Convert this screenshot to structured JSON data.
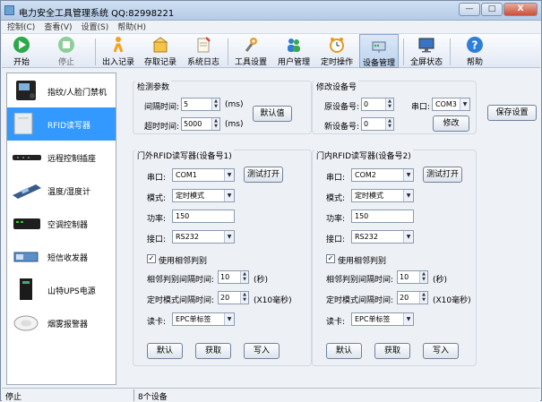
{
  "window": {
    "title": "电力安全工具管理系统  QQ:82998221",
    "controls": {
      "minimize": "—",
      "maximize": "□",
      "close": "X"
    }
  },
  "menu": [
    "控制(C)",
    "查看(V)",
    "设置(S)",
    "帮助(H)"
  ],
  "toolbar": {
    "start": "开始",
    "stop": "停止",
    "checkout": "出入记录",
    "store": "存取记录",
    "log": "系统日志",
    "tools": "工具设置",
    "users": "用户管理",
    "timer": "定时操作",
    "devices": "设备管理",
    "fullscreen": "全屏状态",
    "help": "帮助"
  },
  "sidebar": {
    "items": [
      {
        "label": "指纹/人脸门禁机",
        "icon": "fingerprint-reader-icon"
      },
      {
        "label": "RFID读写器",
        "icon": "rfid-reader-icon",
        "selected": true
      },
      {
        "label": "远程控制插座",
        "icon": "power-strip-icon"
      },
      {
        "label": "温度/湿度计",
        "icon": "thermometer-icon"
      },
      {
        "label": "空调控制器",
        "icon": "ac-controller-icon"
      },
      {
        "label": "短信收发器",
        "icon": "sms-modem-icon"
      },
      {
        "label": "山特UPS电源",
        "icon": "ups-icon"
      },
      {
        "label": "烟雾报警器",
        "icon": "smoke-detector-icon"
      }
    ]
  },
  "detect": {
    "title": "检测参数",
    "interval_label": "间隔时间:",
    "interval_value": "5",
    "timeout_label": "超时时间:",
    "timeout_value": "5000",
    "unit": "(ms)",
    "default_button": "默认值"
  },
  "modify": {
    "title": "修改设备号",
    "old_label": "原设备号:",
    "old_value": "0",
    "new_label": "新设备号:",
    "new_value": "0",
    "port_label": "串口:",
    "port_value": "COM3",
    "modify_button": "修改"
  },
  "save_button": "保存设置",
  "outer": {
    "title": "门外RFID读写器(设备号1)",
    "port_label": "串口:",
    "port_value": "COM1",
    "test_button": "测试打开",
    "mode_label": "模式:",
    "mode_value": "定时模式",
    "power_label": "功率:",
    "power_value": "150",
    "iface_label": "接口:",
    "iface_value": "RS232",
    "adjacent_label": "使用相邻判别",
    "adjacent_checked": true,
    "adj_interval_label": "相邻判别间隔时间:",
    "adj_interval_value": "10",
    "adj_unit": "(秒)",
    "timer_interval_label": "定时模式间隔时间:",
    "timer_interval_value": "20",
    "timer_unit": "(X10毫秒)",
    "card_label": "读卡:",
    "card_value": "EPC单标签",
    "btn_default": "默认",
    "btn_get": "获取",
    "btn_write": "写入"
  },
  "inner": {
    "title": "门内RFID读写器(设备号2)",
    "port_label": "串口:",
    "port_value": "COM2",
    "test_button": "测试打开",
    "mode_label": "模式:",
    "mode_value": "定时模式",
    "power_label": "功率:",
    "power_value": "150",
    "iface_label": "接口:",
    "iface_value": "RS232",
    "adjacent_label": "使用相邻判别",
    "adjacent_checked": true,
    "adj_interval_label": "相邻判别间隔时间:",
    "adj_interval_value": "10",
    "adj_unit": "(秒)",
    "timer_interval_label": "定时模式间隔时间:",
    "timer_interval_value": "20",
    "timer_unit": "(X10毫秒)",
    "card_label": "读卡:",
    "card_value": "EPC单标签",
    "btn_default": "默认",
    "btn_get": "获取",
    "btn_write": "写入"
  },
  "status": {
    "state": "停止",
    "devices": "8个设备"
  },
  "colors": {
    "accent": "#3399ff",
    "selected_tool": "#bcd2ee",
    "close": "#c94f36"
  }
}
